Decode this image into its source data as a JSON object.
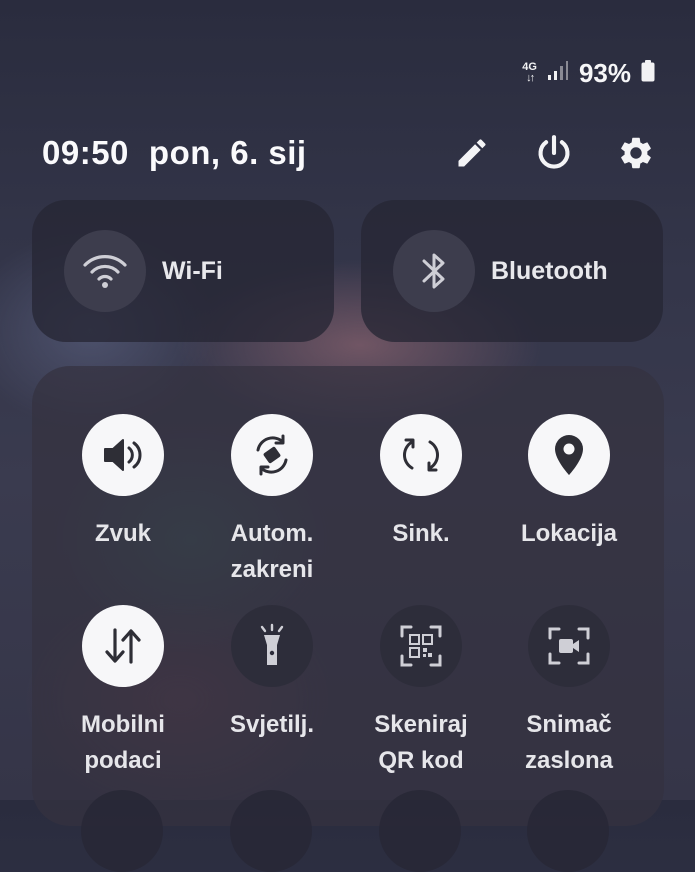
{
  "status_bar": {
    "network_type": "4G",
    "battery_percent": "93%"
  },
  "header": {
    "time": "09:50",
    "date": "pon, 6. sij"
  },
  "tiles": {
    "wifi": {
      "label": "Wi-Fi",
      "icon": "wifi-icon"
    },
    "bluetooth": {
      "label": "Bluetooth",
      "icon": "bluetooth-icon"
    }
  },
  "quick_settings": [
    {
      "label": "Zvuk",
      "icon": "sound-icon",
      "active": true
    },
    {
      "label": "Autom.\nzakreni",
      "icon": "auto-rotate-icon",
      "active": true
    },
    {
      "label": "Sink.",
      "icon": "sync-icon",
      "active": true
    },
    {
      "label": "Lokacija",
      "icon": "location-icon",
      "active": true
    },
    {
      "label": "Mobilni\npodaci",
      "icon": "mobile-data-icon",
      "active": true
    },
    {
      "label": "Svjetilj.",
      "icon": "flashlight-icon",
      "active": false
    },
    {
      "label": "Skeniraj\nQR kod",
      "icon": "qr-scan-icon",
      "active": false
    },
    {
      "label": "Snimač\nzaslona",
      "icon": "screen-recorder-icon",
      "active": false
    }
  ],
  "colors": {
    "tile_on": "#f7f7f9",
    "tile_off": "#2c2c3a",
    "icon_on": "#2e2e36",
    "icon_off": "#cfcfd6"
  }
}
